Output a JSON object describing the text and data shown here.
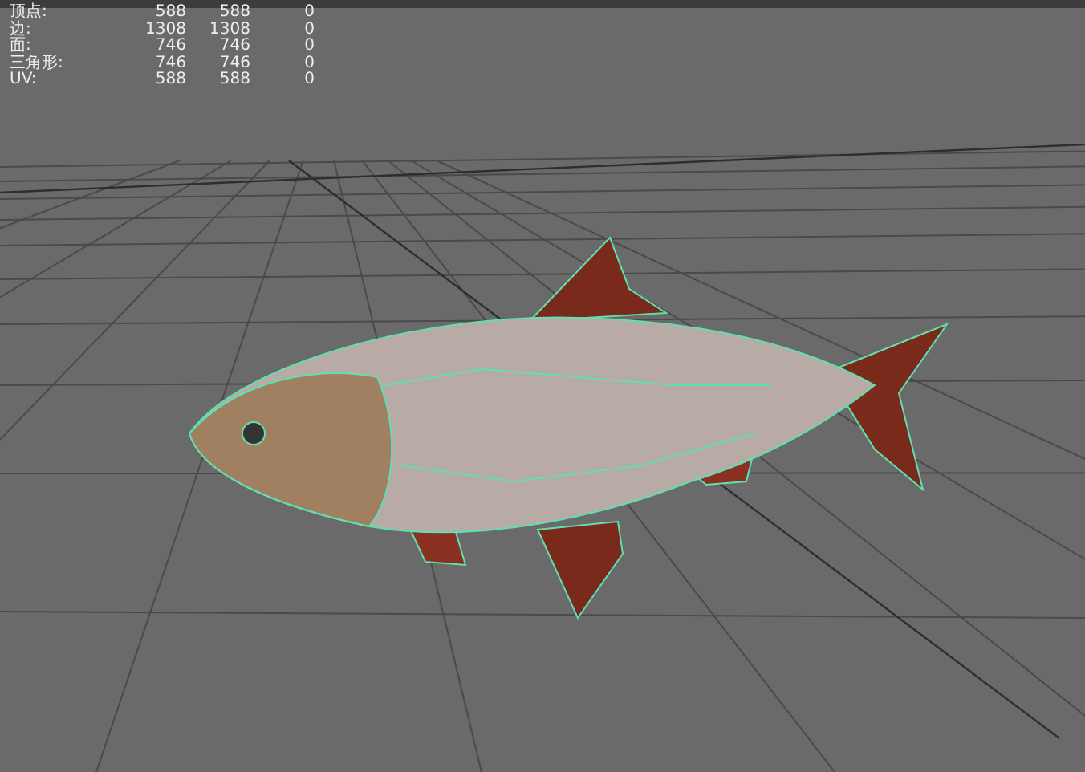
{
  "poly_count": {
    "rows": [
      {
        "label": "顶点:",
        "values": [
          "588",
          "588",
          "0"
        ]
      },
      {
        "label": "边:",
        "values": [
          "1308",
          "1308",
          "0"
        ]
      },
      {
        "label": "面:",
        "values": [
          "746",
          "746",
          "0"
        ]
      },
      {
        "label": "三角形:",
        "values": [
          "746",
          "746",
          "0"
        ]
      },
      {
        "label": "UV:",
        "values": [
          "588",
          "588",
          "0"
        ]
      }
    ]
  }
}
